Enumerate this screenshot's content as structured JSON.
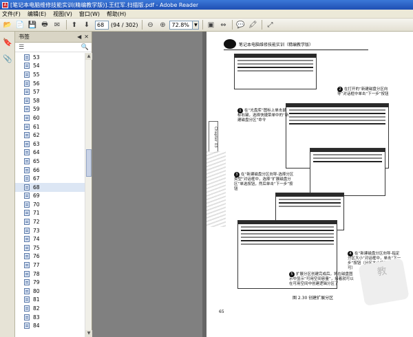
{
  "window": {
    "title": "[笔记本电脑维修技能实训(精编教学版)].王红军.扫描版.pdf - Adobe Reader",
    "app_icon_label": "A"
  },
  "menu": [
    "文件(F)",
    "编辑(E)",
    "视图(V)",
    "窗口(W)",
    "帮助(H)"
  ],
  "toolbar": {
    "page_value": "68",
    "page_count": "(94 / 302)",
    "zoom_value": "72.8%"
  },
  "bookmarks": {
    "title": "书签",
    "items": [
      "53",
      "54",
      "55",
      "56",
      "57",
      "58",
      "59",
      "60",
      "61",
      "62",
      "63",
      "64",
      "65",
      "66",
      "67",
      "68",
      "69",
      "70",
      "71",
      "72",
      "73",
      "74",
      "75",
      "76",
      "77",
      "78",
      "79",
      "80",
      "81",
      "82",
      "83",
      "84"
    ],
    "selected": "68"
  },
  "page": {
    "header": "笔记本电脑维修技能实训（精编教学版）",
    "chapter_tab": "Chapter 03",
    "callouts": {
      "c1": "在“光盘库”图标上单击鼠标右键，选择快捷菜单中的“新建磁盘分区”命令",
      "c2": "在打开的“新建磁盘分区向导”对话框中单击“下一步”按钮",
      "c3": "在“新建磁盘分区向导-选择分区类型”对话框中，选择“扩展磁盘分区”单选按钮，然后单击“下一步”按钮",
      "c4": "在“新建磁盘分区向导-指定分区大小”对话框中，单击“下一步”按钮（分区大小按默认值即可）",
      "c5": "扩展分区创建完成后，将在磁盘图示中显示“可用空间容量”，接着就可以在可用空间中创建逻辑分区了"
    },
    "callout_numbers": [
      "1",
      "2",
      "3",
      "4",
      "5"
    ],
    "figure_caption": "图 2.30  创建扩展分区",
    "page_number": "65",
    "stamp_text": "教"
  }
}
